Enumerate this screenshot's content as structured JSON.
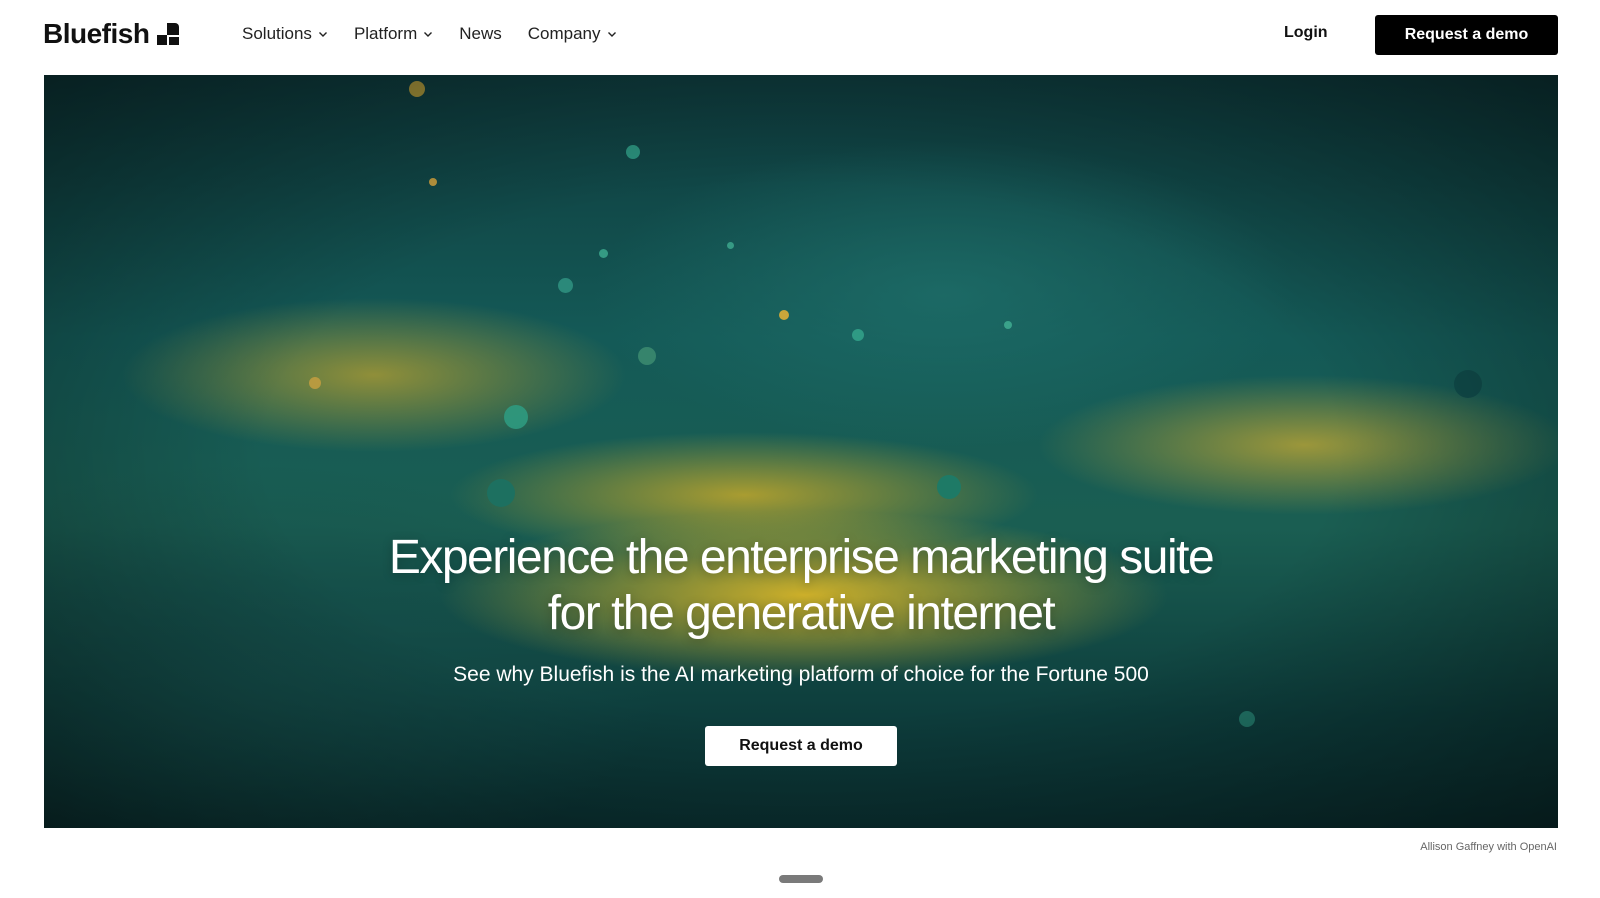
{
  "brand": {
    "name": "Bluefish"
  },
  "nav": {
    "items": [
      {
        "label": "Solutions",
        "has_dropdown": true
      },
      {
        "label": "Platform",
        "has_dropdown": true
      },
      {
        "label": "News",
        "has_dropdown": false
      },
      {
        "label": "Company",
        "has_dropdown": true
      }
    ],
    "login_label": "Login",
    "cta_label": "Request a demo"
  },
  "hero": {
    "title_line1": "Experience the enterprise marketing suite",
    "title_line2": "for the generative internet",
    "subtitle": "See why Bluefish is the AI marketing platform of choice for the Fortune 500",
    "cta_label": "Request a demo"
  },
  "image_credit": "Allison Gaffney with OpenAI",
  "colors": {
    "primary": "#000000",
    "hero_teal": "#145a57",
    "hero_yellow": "#d6b428"
  }
}
